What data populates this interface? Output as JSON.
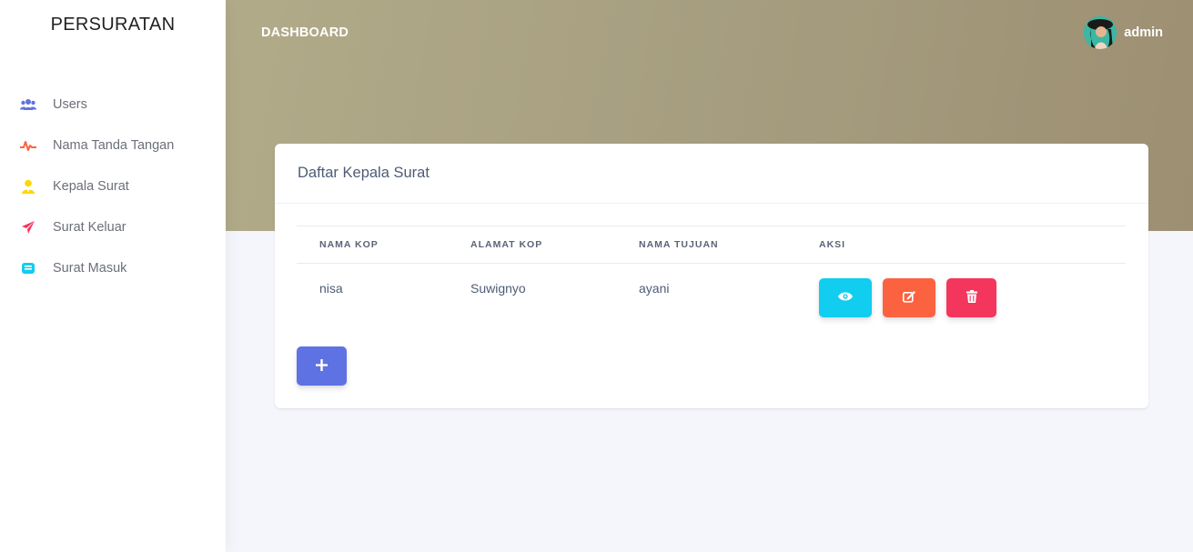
{
  "app": {
    "brand": "PERSURATAN"
  },
  "sidebar": {
    "items": [
      {
        "label": "Users",
        "icon": "users-icon",
        "color": "#5e72e4"
      },
      {
        "label": "Nama Tanda Tangan",
        "icon": "pulse-icon",
        "color": "#fb6340"
      },
      {
        "label": "Kepala Surat",
        "icon": "user-tie-icon",
        "color": "#ffd600"
      },
      {
        "label": "Surat Keluar",
        "icon": "paper-plane-icon",
        "color": "#f5365c"
      },
      {
        "label": "Surat Masuk",
        "icon": "inbox-icon",
        "color": "#11cdef"
      }
    ]
  },
  "header": {
    "title": "DASHBOARD",
    "user_name": "admin"
  },
  "card": {
    "title": "Daftar Kepala Surat",
    "columns": [
      "NAMA KOP",
      "ALAMAT KOP",
      "NAMA TUJUAN",
      "AKSI"
    ],
    "rows": [
      {
        "nama_kop": "nisa",
        "alamat_kop": "Suwignyo",
        "nama_tujuan": "ayani"
      }
    ],
    "actions": {
      "view": "eye-icon",
      "edit": "edit-icon",
      "delete": "trash-icon",
      "add": "plus-icon"
    }
  }
}
